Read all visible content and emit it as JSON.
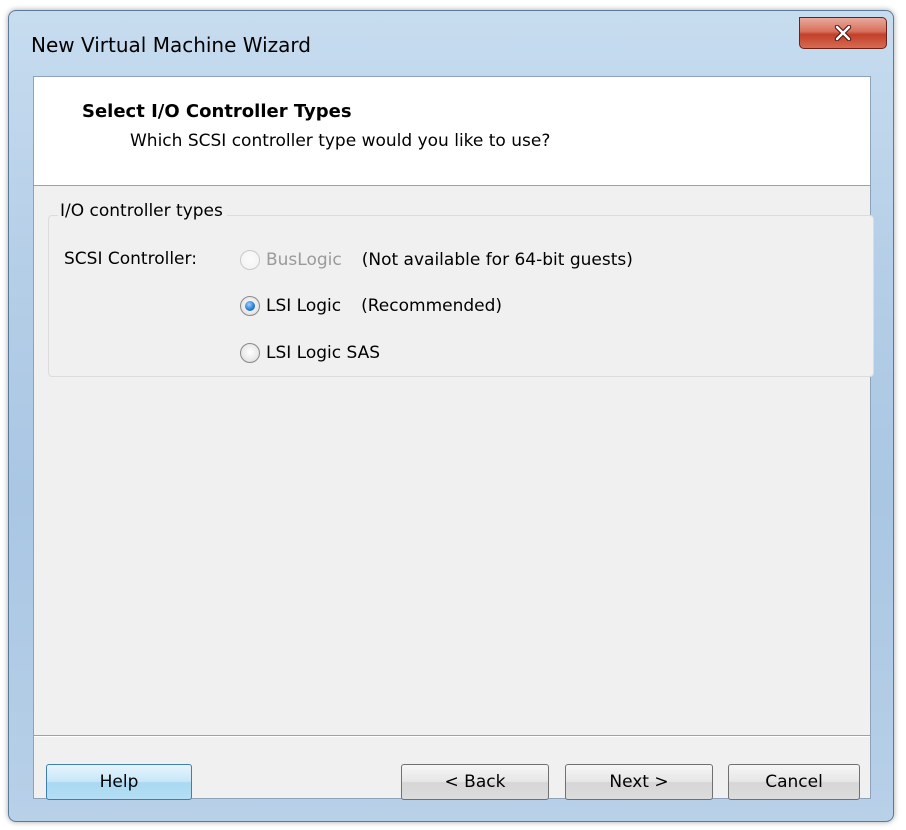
{
  "window": {
    "title": "New Virtual Machine Wizard"
  },
  "header": {
    "title": "Select I/O Controller Types",
    "subtitle": "Which SCSI controller type would you like to use?"
  },
  "group": {
    "legend": "I/O controller types",
    "label": "SCSI Controller:",
    "options": [
      {
        "label": "BusLogic",
        "note": "(Not available for 64-bit guests)",
        "selected": false,
        "enabled": false
      },
      {
        "label": "LSI Logic",
        "note": "(Recommended)",
        "selected": true,
        "enabled": true
      },
      {
        "label": "LSI Logic SAS",
        "note": "",
        "selected": false,
        "enabled": true
      }
    ]
  },
  "buttons": {
    "help": "Help",
    "back": "< Back",
    "next": "Next >",
    "cancel": "Cancel"
  },
  "icons": {
    "close": "close-icon"
  }
}
